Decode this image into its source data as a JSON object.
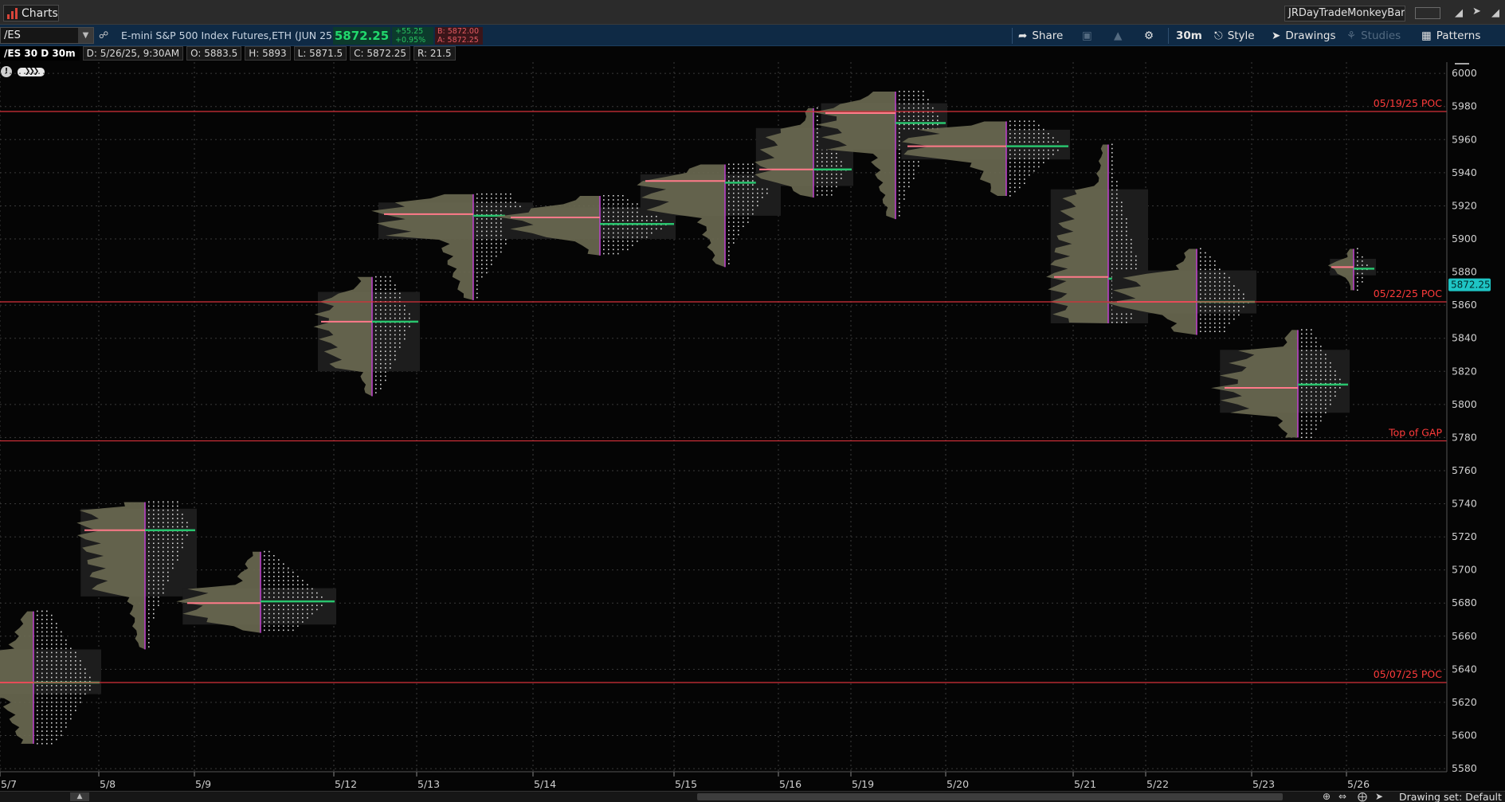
{
  "window": {
    "title": "Charts",
    "account": "JRDayTradeMonkeyBars"
  },
  "toolbar": {
    "symbol": "/ES",
    "description": "E-mini S&P 500 Index Futures,ETH (JUN 25)",
    "last": "5872.25",
    "net_change": "+55.25",
    "pct_change": "+0.95%",
    "bid": "B: 5872.00",
    "ask": "A: 5872.25",
    "share": "Share",
    "timeframe": "30m",
    "style": "Style",
    "drawings": "Drawings",
    "studies": "Studies",
    "patterns": "Patterns"
  },
  "infobar": {
    "header": "/ES 30 D 30m",
    "date": "D: 5/26/25, 9:30AM",
    "open": "O: 5883.5",
    "high": "H: 5893",
    "low": "L: 5871.5",
    "close": "C: 5872.25",
    "range": "R: 21.5"
  },
  "footer": {
    "drawing_set": "Drawing set: Default"
  },
  "colors": {
    "background": "#050505",
    "grid": "#3a3a3a",
    "profile_fill": "#6b6a52",
    "value_area_bg": "#1d1d1d",
    "poc_line": "#ff7a8a",
    "vwap_line": "#29c46e",
    "level_line": "#d6303a",
    "level_label": "#ff3b3b",
    "price_tag_bg": "#1ec5c5"
  },
  "chart_data": {
    "type": "market-profile",
    "ylim": [
      5580,
      6000
    ],
    "y_ticks": [
      5580,
      5600,
      5620,
      5640,
      5660,
      5680,
      5700,
      5720,
      5740,
      5760,
      5780,
      5800,
      5820,
      5840,
      5860,
      5880,
      5900,
      5920,
      5940,
      5960,
      5980,
      6000
    ],
    "current_price": 5872.25,
    "current_price_label": "5872.25",
    "x_labels": [
      "5/7",
      "5/8",
      "5/9",
      "5/12",
      "5/13",
      "5/14",
      "5/15",
      "5/16",
      "5/19",
      "5/20",
      "5/21",
      "5/22",
      "5/23",
      "5/26"
    ],
    "levels": [
      {
        "price": 5977,
        "label": "05/19/25  POC"
      },
      {
        "price": 5862,
        "label": "05/22/25  POC"
      },
      {
        "price": 5778,
        "label": "Top of GAP"
      },
      {
        "price": 5632,
        "label": "05/07/25  POC"
      }
    ],
    "sessions": [
      {
        "date": "5/7",
        "low": 5595,
        "high": 5675,
        "poc": 5632,
        "va_low": 5625,
        "va_high": 5652,
        "vwap": 5632
      },
      {
        "date": "5/8",
        "low": 5652,
        "high": 5741,
        "poc": 5724,
        "va_low": 5684,
        "va_high": 5737,
        "vwap": 5724
      },
      {
        "date": "5/9",
        "low": 5662,
        "high": 5711,
        "poc": 5680,
        "va_low": 5667,
        "va_high": 5689,
        "vwap": 5681
      },
      {
        "date": "5/12",
        "low": 5805,
        "high": 5877,
        "poc": 5850,
        "va_low": 5820,
        "va_high": 5868,
        "vwap": 5850
      },
      {
        "date": "5/13",
        "low": 5863,
        "high": 5927,
        "poc": 5915,
        "va_low": 5900,
        "va_high": 5922,
        "vwap": 5914
      },
      {
        "date": "5/14",
        "low": 5890,
        "high": 5926,
        "poc": 5913,
        "va_low": 5900,
        "va_high": 5919,
        "vwap": 5909
      },
      {
        "date": "5/15",
        "low": 5883,
        "high": 5945,
        "poc": 5935,
        "va_low": 5914,
        "va_high": 5939,
        "vwap": 5934
      },
      {
        "date": "5/16",
        "low": 5925,
        "high": 5979,
        "poc": 5942,
        "va_low": 5932,
        "va_high": 5967,
        "vwap": 5942
      },
      {
        "date": "5/19",
        "low": 5912,
        "high": 5989,
        "poc": 5976,
        "va_low": 5954,
        "va_high": 5982,
        "vwap": 5970
      },
      {
        "date": "5/20",
        "low": 5926,
        "high": 5971,
        "poc": 5956,
        "va_low": 5948,
        "va_high": 5966,
        "vwap": 5956
      },
      {
        "date": "5/21",
        "low": 5849,
        "high": 5957,
        "poc": 5877,
        "va_low": 5849,
        "va_high": 5930,
        "vwap": 5876
      },
      {
        "date": "5/22",
        "low": 5842,
        "high": 5894,
        "poc": 5862,
        "va_low": 5855,
        "va_high": 5881,
        "vwap": 5862
      },
      {
        "date": "5/23",
        "low": 5780,
        "high": 5845,
        "poc": 5810,
        "va_low": 5795,
        "va_high": 5833,
        "vwap": 5812
      },
      {
        "date": "5/26",
        "low": 5869,
        "high": 5894,
        "poc": 5883,
        "va_low": 5878,
        "va_high": 5888,
        "vwap": 5882
      }
    ]
  }
}
